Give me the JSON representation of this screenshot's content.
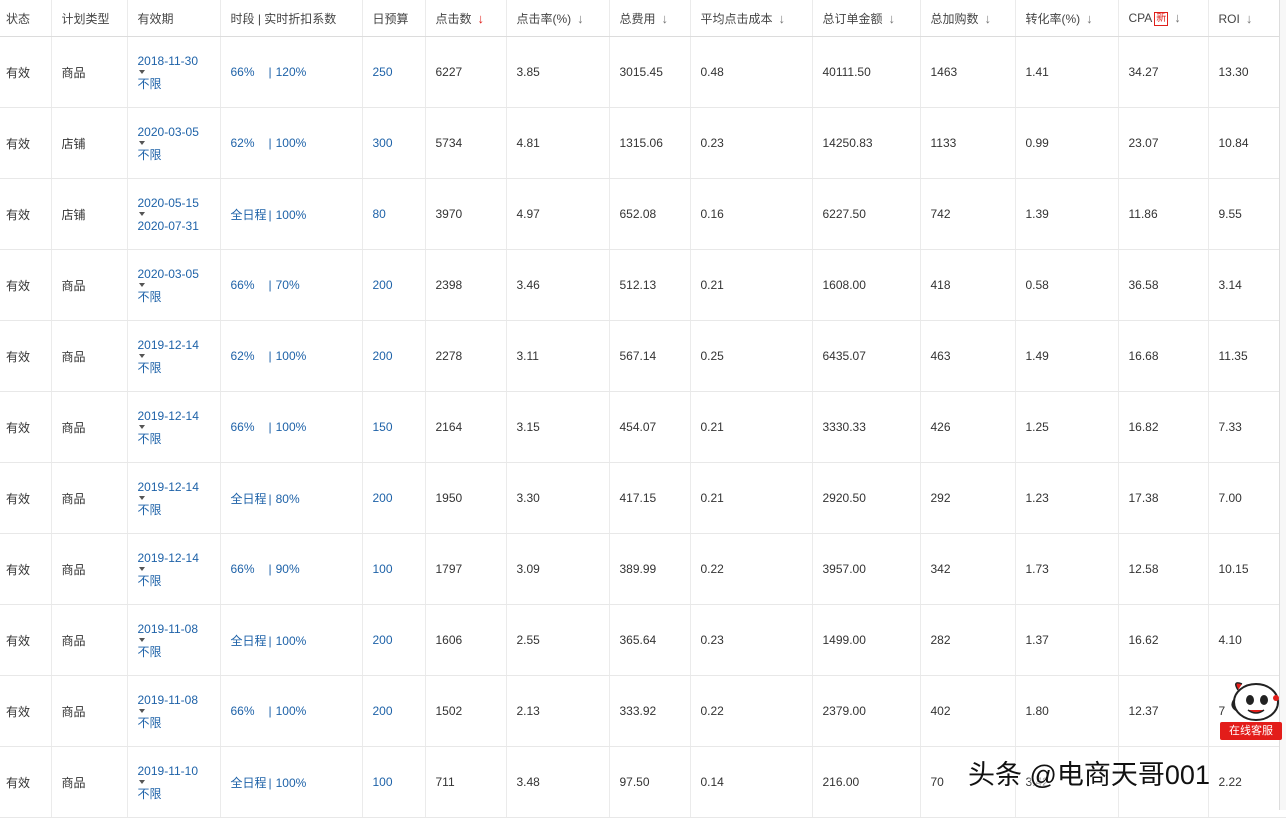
{
  "table": {
    "headers": [
      {
        "label": "状态"
      },
      {
        "label": "计划类型"
      },
      {
        "label": "有效期"
      },
      {
        "label": "时段 | 实时折扣系数"
      },
      {
        "label": "日预算"
      },
      {
        "label": "点击数",
        "arrow": "↓",
        "active": true
      },
      {
        "label": "点击率(%)",
        "arrow": "↓"
      },
      {
        "label": "总费用",
        "arrow": "↓"
      },
      {
        "label": "平均点击成本",
        "arrow": "↓"
      },
      {
        "label": "总订单金额",
        "arrow": "↓"
      },
      {
        "label": "总加购数",
        "arrow": "↓"
      },
      {
        "label": "转化率(%)",
        "arrow": "↓"
      },
      {
        "label": "CPA",
        "badge": "新",
        "arrow": "↓"
      },
      {
        "label": "ROI",
        "arrow": "↓"
      }
    ],
    "rows": [
      {
        "status": "有效",
        "type": "商品",
        "date_start": "2018-11-30",
        "date_end": "不限",
        "time": "66%",
        "discount": "120%",
        "budget": "250",
        "clicks": "6227",
        "ctr": "3.85",
        "cost": "3015.45",
        "cpc": "0.48",
        "order_amount": "40111.50",
        "cart": "1463",
        "cvr": "1.41",
        "cpa": "34.27",
        "roi": "13.30"
      },
      {
        "status": "有效",
        "type": "店铺",
        "date_start": "2020-03-05",
        "date_end": "不限",
        "time": "62%",
        "discount": "100%",
        "budget": "300",
        "clicks": "5734",
        "ctr": "4.81",
        "cost": "1315.06",
        "cpc": "0.23",
        "order_amount": "14250.83",
        "cart": "1133",
        "cvr": "0.99",
        "cpa": "23.07",
        "roi": "10.84"
      },
      {
        "status": "有效",
        "type": "店铺",
        "date_start": "2020-05-15",
        "date_end": "2020-07-31",
        "time": "全日程",
        "discount": "100%",
        "budget": "80",
        "clicks": "3970",
        "ctr": "4.97",
        "cost": "652.08",
        "cpc": "0.16",
        "order_amount": "6227.50",
        "cart": "742",
        "cvr": "1.39",
        "cpa": "11.86",
        "roi": "9.55"
      },
      {
        "status": "有效",
        "type": "商品",
        "date_start": "2020-03-05",
        "date_end": "不限",
        "time": "66%",
        "discount": "70%",
        "budget": "200",
        "clicks": "2398",
        "ctr": "3.46",
        "cost": "512.13",
        "cpc": "0.21",
        "order_amount": "1608.00",
        "cart": "418",
        "cvr": "0.58",
        "cpa": "36.58",
        "roi": "3.14"
      },
      {
        "status": "有效",
        "type": "商品",
        "date_start": "2019-12-14",
        "date_end": "不限",
        "time": "62%",
        "discount": "100%",
        "budget": "200",
        "clicks": "2278",
        "ctr": "3.11",
        "cost": "567.14",
        "cpc": "0.25",
        "order_amount": "6435.07",
        "cart": "463",
        "cvr": "1.49",
        "cpa": "16.68",
        "roi": "11.35"
      },
      {
        "status": "有效",
        "type": "商品",
        "date_start": "2019-12-14",
        "date_end": "不限",
        "time": "66%",
        "discount": "100%",
        "budget": "150",
        "clicks": "2164",
        "ctr": "3.15",
        "cost": "454.07",
        "cpc": "0.21",
        "order_amount": "3330.33",
        "cart": "426",
        "cvr": "1.25",
        "cpa": "16.82",
        "roi": "7.33"
      },
      {
        "status": "有效",
        "type": "商品",
        "date_start": "2019-12-14",
        "date_end": "不限",
        "time": "全日程",
        "discount": "80%",
        "budget": "200",
        "clicks": "1950",
        "ctr": "3.30",
        "cost": "417.15",
        "cpc": "0.21",
        "order_amount": "2920.50",
        "cart": "292",
        "cvr": "1.23",
        "cpa": "17.38",
        "roi": "7.00"
      },
      {
        "status": "有效",
        "type": "商品",
        "date_start": "2019-12-14",
        "date_end": "不限",
        "time": "66%",
        "discount": "90%",
        "budget": "100",
        "clicks": "1797",
        "ctr": "3.09",
        "cost": "389.99",
        "cpc": "0.22",
        "order_amount": "3957.00",
        "cart": "342",
        "cvr": "1.73",
        "cpa": "12.58",
        "roi": "10.15"
      },
      {
        "status": "有效",
        "type": "商品",
        "date_start": "2019-11-08",
        "date_end": "不限",
        "time": "全日程",
        "discount": "100%",
        "budget": "200",
        "clicks": "1606",
        "ctr": "2.55",
        "cost": "365.64",
        "cpc": "0.23",
        "order_amount": "1499.00",
        "cart": "282",
        "cvr": "1.37",
        "cpa": "16.62",
        "roi": "4.10"
      },
      {
        "status": "有效",
        "type": "商品",
        "date_start": "2019-11-08",
        "date_end": "不限",
        "time": "66%",
        "discount": "100%",
        "budget": "200",
        "clicks": "1502",
        "ctr": "2.13",
        "cost": "333.92",
        "cpc": "0.22",
        "order_amount": "2379.00",
        "cart": "402",
        "cvr": "1.80",
        "cpa": "12.37",
        "roi": "7"
      },
      {
        "status": "有效",
        "type": "商品",
        "date_start": "2019-11-10",
        "date_end": "不限",
        "time": "全日程",
        "discount": "100%",
        "budget": "100",
        "clicks": "711",
        "ctr": "3.48",
        "cost": "97.50",
        "cpc": "0.14",
        "order_amount": "216.00",
        "cart": "70",
        "cvr": "3.42",
        "cpa": "",
        "roi": "2.22"
      }
    ]
  },
  "separator": "|",
  "service_widget": {
    "label": "在线客服",
    "icon": "customer-service-mascot-icon"
  },
  "watermark": "头条 @电商天哥001",
  "colors": {
    "link": "#1e62a8",
    "active_arrow": "#e0201b",
    "badge": "#e0201b",
    "service_bg": "#e31d1a",
    "border": "#ebebeb"
  }
}
